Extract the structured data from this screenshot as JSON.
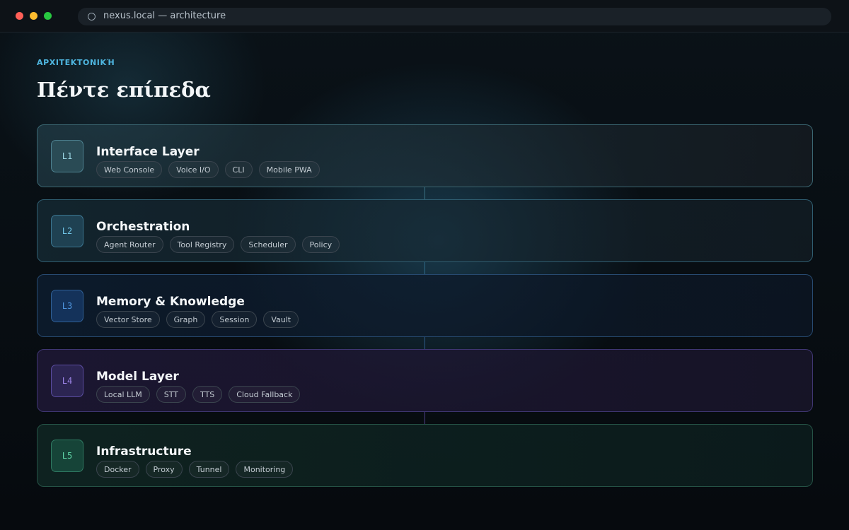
{
  "window": {
    "url": "nexus.local — architecture"
  },
  "header": {
    "eyebrow": "ΑΡΧΙΤΕΚΤΟΝΙΚΉ",
    "title": "Πέντε επίπεδα"
  },
  "layers": [
    {
      "badge": "L1",
      "title": "Interface Layer",
      "tags": [
        "Web Console",
        "Voice I/O",
        "CLI",
        "Mobile PWA"
      ],
      "accent": "#9bd5e2"
    },
    {
      "badge": "L2",
      "title": "Orchestration",
      "tags": [
        "Agent Router",
        "Tool Registry",
        "Scheduler",
        "Policy"
      ],
      "accent": "#6fc3e5"
    },
    {
      "badge": "L3",
      "title": "Memory & Knowledge",
      "tags": [
        "Vector Store",
        "Graph",
        "Session",
        "Vault"
      ],
      "accent": "#4f95de"
    },
    {
      "badge": "L4",
      "title": "Model Layer",
      "tags": [
        "Local LLM",
        "STT",
        "TTS",
        "Cloud Fallback"
      ],
      "accent": "#9d85e8"
    },
    {
      "badge": "L5",
      "title": "Infrastructure",
      "tags": [
        "Docker",
        "Proxy",
        "Tunnel",
        "Monitoring"
      ],
      "accent": "#5fd3a6"
    }
  ]
}
